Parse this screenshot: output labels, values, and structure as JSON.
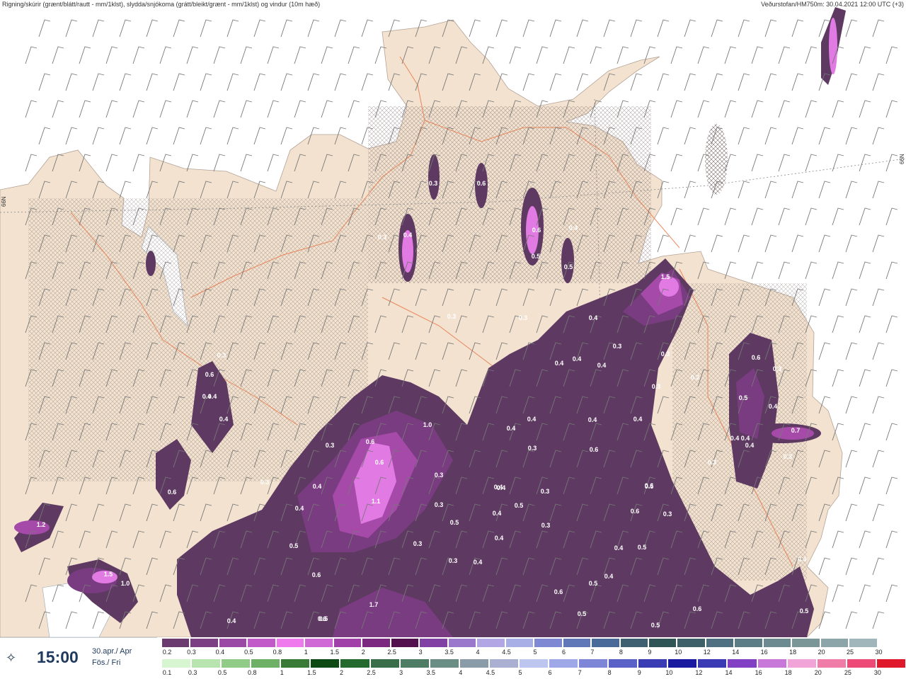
{
  "header": {
    "left_title": "Rigning/skúrir (grænt/blátt/rautt - mm/1klst), slydda/snjókoma (grátt/bleikt/grænt - mm/1klst) og vindur (10m hæð)",
    "right_title": "Veðurstofan/HM750m: 30.04.2021 12:00 UTC (+3)"
  },
  "grid_labels": {
    "lat_left": "66N",
    "lat_right": "66N"
  },
  "time_panel": {
    "icon": "spinner-icon",
    "time": "15:00",
    "date_line1": "30.apr./ Apr",
    "date_line2": "Fös./ Fri"
  },
  "legend": {
    "snow_scale": {
      "labels": [
        "0.2",
        "0.3",
        "0.4",
        "0.5",
        "0.8",
        "1",
        "1.5",
        "2",
        "2.5",
        "3",
        "3.5",
        "4",
        "4.5",
        "5",
        "6",
        "7",
        "8",
        "9",
        "10",
        "12",
        "14",
        "16",
        "18",
        "20",
        "25",
        "30"
      ],
      "colors": [
        "#6b3a6e",
        "#7c3f84",
        "#9a4aa4",
        "#c25ac9",
        "#ef7aee",
        "#d068d6",
        "#a040a8",
        "#7a2880",
        "#52104e",
        "#8040a4",
        "#9a78cc",
        "#b2a6e4",
        "#a8aee6",
        "#7f88d2",
        "#6078b8",
        "#4a6a9a",
        "#3e6070",
        "#2f5556",
        "#3e6068",
        "#4e7080",
        "#5c7c86",
        "#6c8a90",
        "#7a9696",
        "#8ba5a8",
        "#a0b6ba",
        "#ffffff"
      ]
    },
    "rain_scale": {
      "labels": [
        "0.1",
        "0.3",
        "0.5",
        "0.8",
        "1",
        "1.5",
        "2",
        "2.5",
        "3",
        "3.5",
        "4",
        "4.5",
        "5",
        "6",
        "7",
        "8",
        "9",
        "10",
        "12",
        "14",
        "16",
        "18",
        "20",
        "25",
        "30"
      ],
      "colors": [
        "#d6f5d0",
        "#b8e4b0",
        "#90cc88",
        "#6eb066",
        "#387a36",
        "#0e4a14",
        "#246a2e",
        "#3a6e4a",
        "#4e7c64",
        "#6a8e84",
        "#8a9ca8",
        "#a9b0d2",
        "#bcc6ee",
        "#9fa8e6",
        "#7e86d8",
        "#5a62c8",
        "#3a3cb4",
        "#1a1aa0",
        "#3a3ab4",
        "#8240c4",
        "#c878d8",
        "#f0a4d8",
        "#f07ca8",
        "#ee4a78",
        "#e0182c"
      ]
    }
  },
  "map": {
    "land_color": "#f2e2cf",
    "precip_colors": {
      "dark": "#5e3a62",
      "mid": "#7a3c80",
      "light": "#a64aaa",
      "bright": "#e27ae4"
    },
    "value_labels": [
      "0.3",
      "0.4",
      "0.5",
      "0.6",
      "0.3",
      "0.4",
      "0.3",
      "0.5",
      "0.3",
      "0.6",
      "0.4",
      "0.6",
      "0.3",
      "0.4",
      "0.4",
      "1.5",
      "0.4",
      "0.3",
      "0.4",
      "0.4",
      "0.3",
      "0.4",
      "0.3",
      "0.4",
      "0.2",
      "0.6",
      "0.3",
      "0.5",
      "0.4",
      "0.7",
      "0.4",
      "0.4",
      "0.3",
      "0.3",
      "0.5",
      "0.6",
      "0.5",
      "0.4",
      "0.6",
      "0.5",
      "1.2",
      "1.5",
      "1.0",
      "0.6",
      "1.0",
      "0.3",
      "0.4",
      "0.6",
      "0.6",
      "1.1",
      "0.4",
      "0.5",
      "0.6",
      "0.3",
      "0.4",
      "0.4",
      "0.5",
      "0.3",
      "0.3",
      "0.5",
      "0.3",
      "0.4",
      "0.3",
      "0.4",
      "0.6",
      "0.3",
      "0.4",
      "0.4",
      "0.4",
      "0.6",
      "0.4",
      "0.5",
      "0.3",
      "0.3",
      "0.3",
      "0.4",
      "0.6",
      "0.5",
      "0.5",
      "0.4",
      "0.5",
      "0.4",
      "0.6",
      "1.7",
      "0.4"
    ]
  }
}
